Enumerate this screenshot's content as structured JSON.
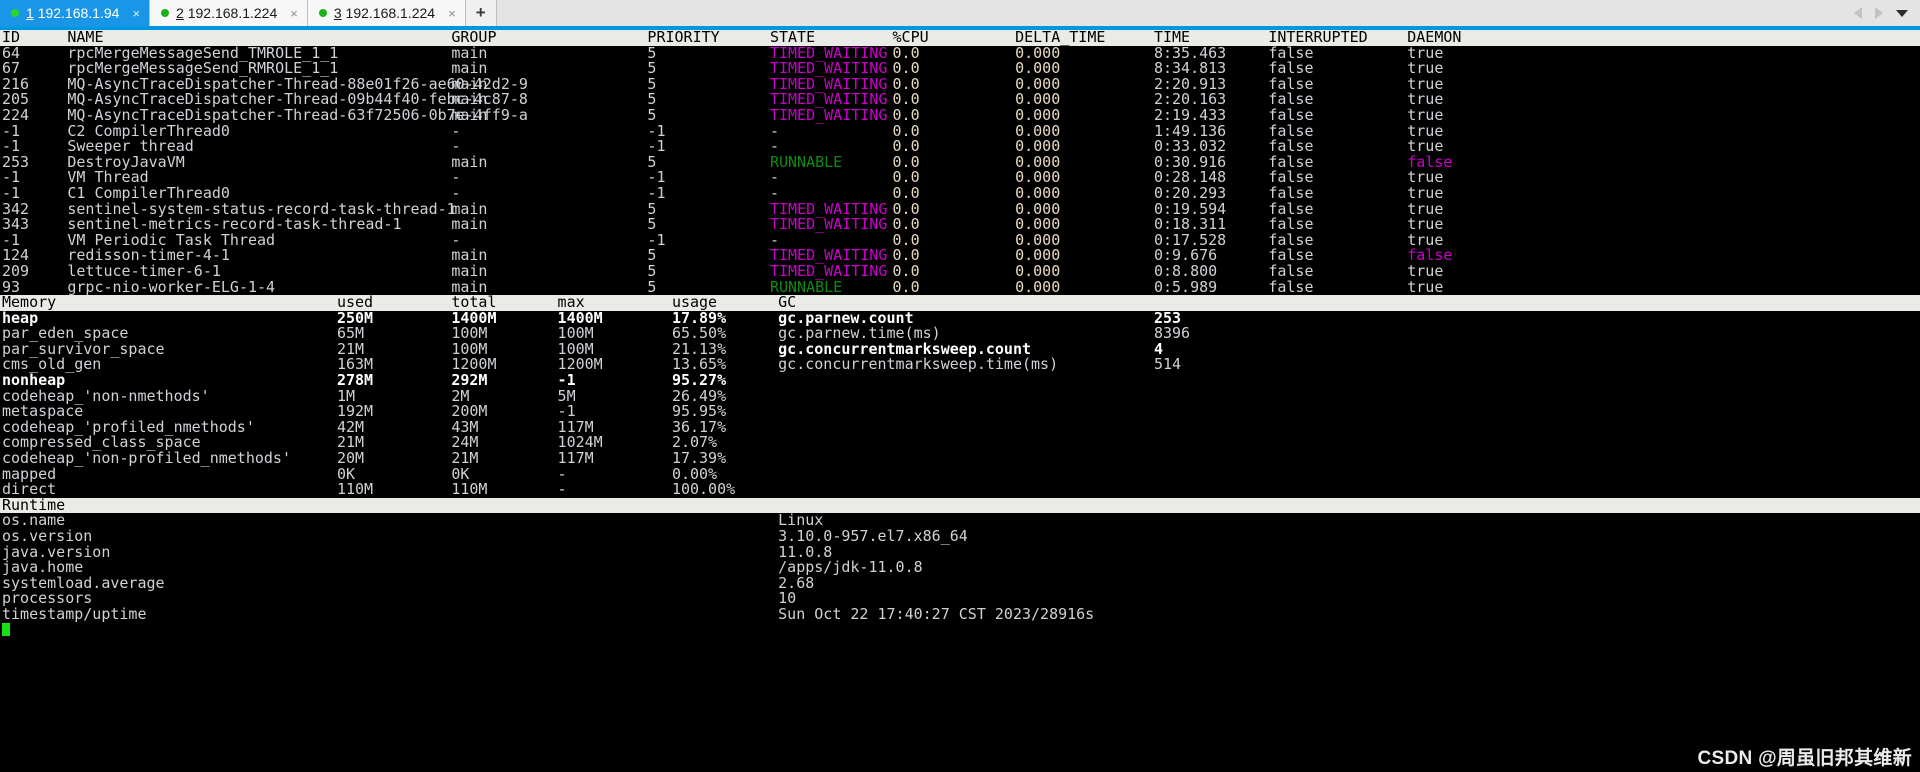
{
  "window": {
    "tabs": [
      {
        "index": "1",
        "host": "192.168.1.94",
        "active": true,
        "close_label": "×",
        "status_dot": "connected-dot"
      },
      {
        "index": "2",
        "host": "192.168.1.224",
        "active": false,
        "close_label": "×",
        "status_dot": "connected-dot"
      },
      {
        "index": "3",
        "host": "192.168.1.224",
        "active": false,
        "close_label": "×",
        "status_dot": "connected-dot"
      }
    ],
    "new_tab_label": "+",
    "nav_prev_icon": "triangle-left-icon",
    "nav_next_icon": "triangle-right-icon",
    "menu_icon": "caret-down-icon",
    "accent_color": "#0096e0",
    "active_tab_color": "#1996e8"
  },
  "colors": {
    "background": "#000000",
    "foreground": "#cfd2d6",
    "header_bar_bg": "#eaeae6",
    "state_timed_waiting": "#cc00cc",
    "state_runnable": "#0f8b0f",
    "number": "#e8d8c0",
    "daemon_false": "#cc00cc",
    "cursor": "#14e014"
  },
  "threads": {
    "columns": [
      "ID",
      "NAME",
      "GROUP",
      "PRIORITY",
      "STATE",
      "%CPU",
      "DELTA_TIME",
      "TIME",
      "INTERRUPTED",
      "DAEMON"
    ],
    "rows": [
      {
        "id": "64",
        "name": "rpcMergeMessageSend_TMROLE_1_1",
        "group": "main",
        "priority": "5",
        "state": "TIMED_WAITING",
        "cpu": "0.0",
        "delta_time": "0.000",
        "time": "8:35.463",
        "interrupted": "false",
        "daemon": "true"
      },
      {
        "id": "67",
        "name": "rpcMergeMessageSend_RMROLE_1_1",
        "group": "main",
        "priority": "5",
        "state": "TIMED_WAITING",
        "cpu": "0.0",
        "delta_time": "0.000",
        "time": "8:34.813",
        "interrupted": "false",
        "daemon": "true"
      },
      {
        "id": "216",
        "name": "MQ-AsyncTraceDispatcher-Thread-88e01f26-ae60-42d2-9",
        "group": "main",
        "priority": "5",
        "state": "TIMED_WAITING",
        "cpu": "0.0",
        "delta_time": "0.000",
        "time": "2:20.913",
        "interrupted": "false",
        "daemon": "true"
      },
      {
        "id": "205",
        "name": "MQ-AsyncTraceDispatcher-Thread-09b44f40-febc-4c87-8",
        "group": "main",
        "priority": "5",
        "state": "TIMED_WAITING",
        "cpu": "0.0",
        "delta_time": "0.000",
        "time": "2:20.163",
        "interrupted": "false",
        "daemon": "true"
      },
      {
        "id": "224",
        "name": "MQ-AsyncTraceDispatcher-Thread-63f72506-0b7e-4ff9-a",
        "group": "main",
        "priority": "5",
        "state": "TIMED_WAITING",
        "cpu": "0.0",
        "delta_time": "0.000",
        "time": "2:19.433",
        "interrupted": "false",
        "daemon": "true"
      },
      {
        "id": "-1",
        "name": "C2 CompilerThread0",
        "group": "-",
        "priority": "-1",
        "state": "-",
        "cpu": "0.0",
        "delta_time": "0.000",
        "time": "1:49.136",
        "interrupted": "false",
        "daemon": "true"
      },
      {
        "id": "-1",
        "name": "Sweeper thread",
        "group": "-",
        "priority": "-1",
        "state": "-",
        "cpu": "0.0",
        "delta_time": "0.000",
        "time": "0:33.032",
        "interrupted": "false",
        "daemon": "true"
      },
      {
        "id": "253",
        "name": "DestroyJavaVM",
        "group": "main",
        "priority": "5",
        "state": "RUNNABLE",
        "cpu": "0.0",
        "delta_time": "0.000",
        "time": "0:30.916",
        "interrupted": "false",
        "daemon": "false"
      },
      {
        "id": "-1",
        "name": "VM Thread",
        "group": "-",
        "priority": "-1",
        "state": "-",
        "cpu": "0.0",
        "delta_time": "0.000",
        "time": "0:28.148",
        "interrupted": "false",
        "daemon": "true"
      },
      {
        "id": "-1",
        "name": "C1 CompilerThread0",
        "group": "-",
        "priority": "-1",
        "state": "-",
        "cpu": "0.0",
        "delta_time": "0.000",
        "time": "0:20.293",
        "interrupted": "false",
        "daemon": "true"
      },
      {
        "id": "342",
        "name": "sentinel-system-status-record-task-thread-1",
        "group": "main",
        "priority": "5",
        "state": "TIMED_WAITING",
        "cpu": "0.0",
        "delta_time": "0.000",
        "time": "0:19.594",
        "interrupted": "false",
        "daemon": "true"
      },
      {
        "id": "343",
        "name": "sentinel-metrics-record-task-thread-1",
        "group": "main",
        "priority": "5",
        "state": "TIMED_WAITING",
        "cpu": "0.0",
        "delta_time": "0.000",
        "time": "0:18.311",
        "interrupted": "false",
        "daemon": "true"
      },
      {
        "id": "-1",
        "name": "VM Periodic Task Thread",
        "group": "-",
        "priority": "-1",
        "state": "-",
        "cpu": "0.0",
        "delta_time": "0.000",
        "time": "0:17.528",
        "interrupted": "false",
        "daemon": "true"
      },
      {
        "id": "124",
        "name": "redisson-timer-4-1",
        "group": "main",
        "priority": "5",
        "state": "TIMED_WAITING",
        "cpu": "0.0",
        "delta_time": "0.000",
        "time": "0:9.676",
        "interrupted": "false",
        "daemon": "false"
      },
      {
        "id": "209",
        "name": "lettuce-timer-6-1",
        "group": "main",
        "priority": "5",
        "state": "TIMED_WAITING",
        "cpu": "0.0",
        "delta_time": "0.000",
        "time": "0:8.800",
        "interrupted": "false",
        "daemon": "true"
      },
      {
        "id": "93",
        "name": "grpc-nio-worker-ELG-1-4",
        "group": "main",
        "priority": "5",
        "state": "RUNNABLE",
        "cpu": "0.0",
        "delta_time": "0.000",
        "time": "0:5.989",
        "interrupted": "false",
        "daemon": "true"
      }
    ]
  },
  "memory": {
    "columns": [
      "Memory",
      "used",
      "total",
      "max",
      "usage",
      "GC"
    ],
    "rows": [
      {
        "name": "heap",
        "used": "250M",
        "total": "1400M",
        "max": "1400M",
        "usage": "17.89%",
        "bold": true
      },
      {
        "name": "par_eden_space",
        "used": "65M",
        "total": "100M",
        "max": "100M",
        "usage": "65.50%",
        "bold": false
      },
      {
        "name": "par_survivor_space",
        "used": "21M",
        "total": "100M",
        "max": "100M",
        "usage": "21.13%",
        "bold": false
      },
      {
        "name": "cms_old_gen",
        "used": "163M",
        "total": "1200M",
        "max": "1200M",
        "usage": "13.65%",
        "bold": false
      },
      {
        "name": "nonheap",
        "used": "278M",
        "total": "292M",
        "max": "-1",
        "usage": "95.27%",
        "bold": true
      },
      {
        "name": "codeheap_'non-nmethods'",
        "used": "1M",
        "total": "2M",
        "max": "5M",
        "usage": "26.49%",
        "bold": false
      },
      {
        "name": "metaspace",
        "used": "192M",
        "total": "200M",
        "max": "-1",
        "usage": "95.95%",
        "bold": false
      },
      {
        "name": "codeheap_'profiled_nmethods'",
        "used": "42M",
        "total": "43M",
        "max": "117M",
        "usage": "36.17%",
        "bold": false
      },
      {
        "name": "compressed_class_space",
        "used": "21M",
        "total": "24M",
        "max": "1024M",
        "usage": "2.07%",
        "bold": false
      },
      {
        "name": "codeheap_'non-profiled_nmethods'",
        "used": "20M",
        "total": "21M",
        "max": "117M",
        "usage": "17.39%",
        "bold": false
      },
      {
        "name": "mapped",
        "used": "0K",
        "total": "0K",
        "max": "-",
        "usage": "0.00%",
        "bold": false
      },
      {
        "name": "direct",
        "used": "110M",
        "total": "110M",
        "max": "-",
        "usage": "100.00%",
        "bold": false
      }
    ],
    "gc": [
      {
        "key": "gc.parnew.count",
        "value": "253",
        "bold": true
      },
      {
        "key": "gc.parnew.time(ms)",
        "value": "8396",
        "bold": false
      },
      {
        "key": "gc.concurrentmarksweep.count",
        "value": "4",
        "bold": true
      },
      {
        "key": "gc.concurrentmarksweep.time(ms)",
        "value": "514",
        "bold": false
      }
    ]
  },
  "runtime": {
    "section_title": "Runtime",
    "rows": [
      {
        "key": "os.name",
        "value": "Linux"
      },
      {
        "key": "os.version",
        "value": "3.10.0-957.el7.x86_64"
      },
      {
        "key": "java.version",
        "value": "11.0.8"
      },
      {
        "key": "java.home",
        "value": "/apps/jdk-11.0.8"
      },
      {
        "key": "systemload.average",
        "value": "2.68"
      },
      {
        "key": "processors",
        "value": "10"
      },
      {
        "key": "timestamp/uptime",
        "value": "Sun Oct 22 17:40:27 CST 2023/28916s"
      }
    ]
  },
  "watermark": {
    "text": "CSDN @周虽旧邦其维新"
  }
}
